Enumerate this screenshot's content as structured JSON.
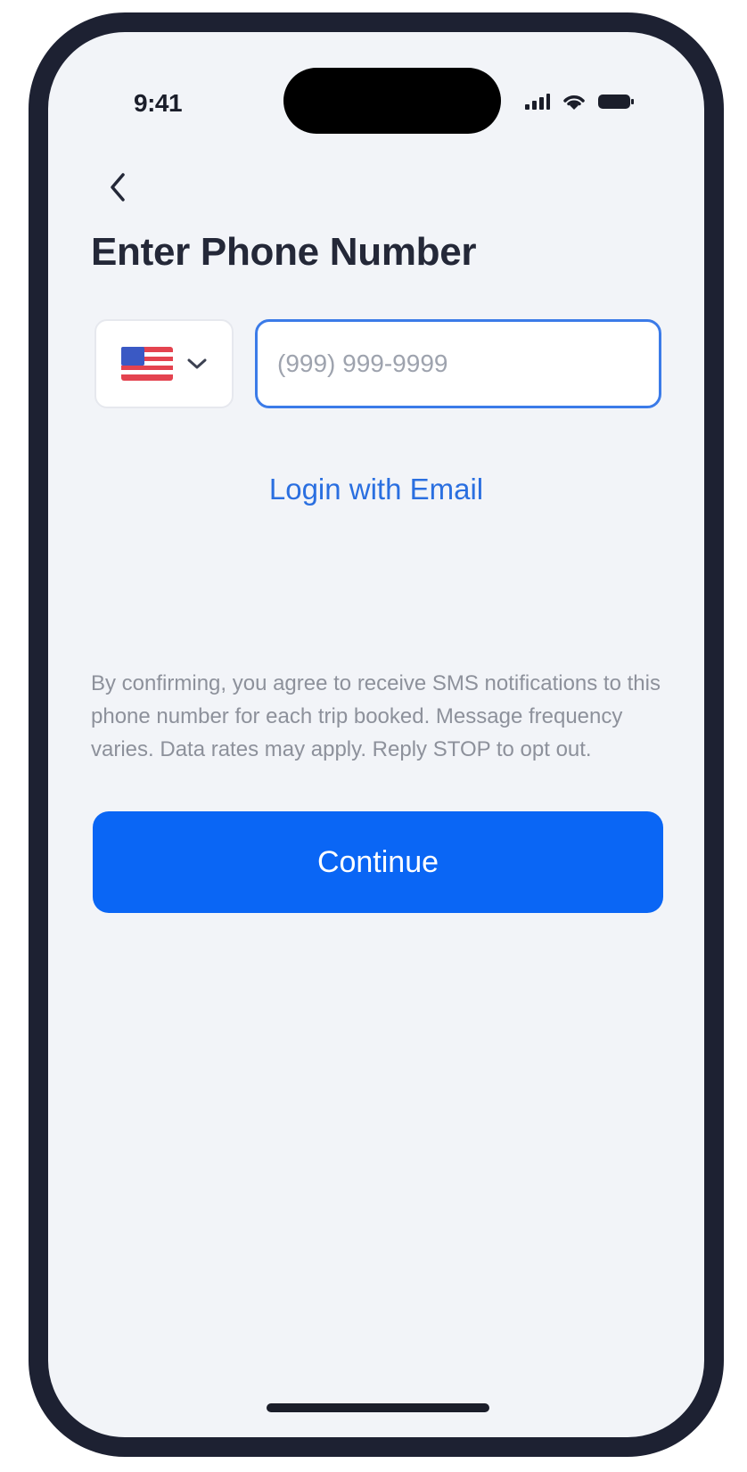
{
  "status_bar": {
    "time": "9:41",
    "icons": [
      "signal-icon",
      "wifi-icon",
      "battery-icon"
    ]
  },
  "header": {
    "back_icon": "chevron-left-icon",
    "title": "Enter Phone Number"
  },
  "phone_form": {
    "country_flag": "us-flag-icon",
    "country_dropdown_icon": "chevron-down-icon",
    "phone_value": "",
    "phone_placeholder": "(999) 999-9999"
  },
  "login_email_link": "Login with Email",
  "consent_text": "By confirming, you agree to receive SMS notifications to this phone number for each trip booked. Message frequency varies. Data rates may apply. Reply STOP to opt out.",
  "continue_label": "Continue",
  "colors": {
    "accent": "#0a66f5",
    "link": "#2a6fe0",
    "frame": "#1d2132",
    "background": "#f2f4f8"
  }
}
